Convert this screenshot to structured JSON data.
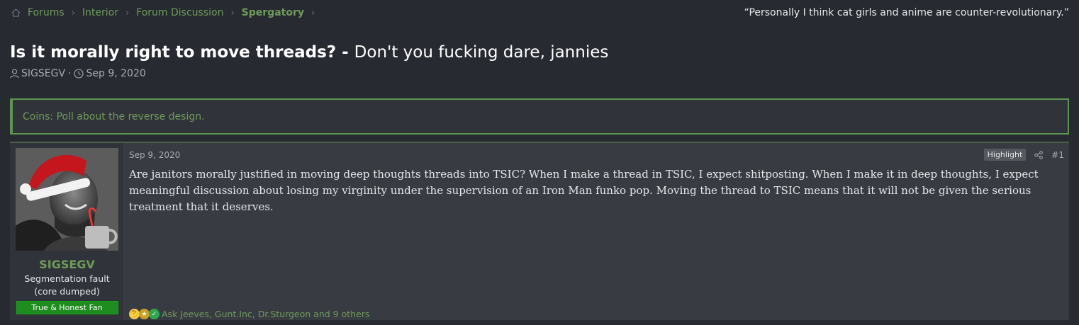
{
  "breadcrumb": {
    "items": [
      {
        "label": "Forums"
      },
      {
        "label": "Interior"
      },
      {
        "label": "Forum Discussion"
      },
      {
        "label": "Spergatory"
      }
    ]
  },
  "header_quote": "“Personally I think cat girls and anime are counter-revolutionary.”",
  "thread": {
    "title_prefix": "Is it morally right to move threads? -",
    "title_sub": "Don't you fucking dare, jannies",
    "author": "SIGSEGV",
    "date": "Sep 9, 2020"
  },
  "notice": {
    "text": "Coins: Poll about the reverse design."
  },
  "post": {
    "username": "SIGSEGV",
    "user_title": "Segmentation fault (core dumped)",
    "banner": "True & Honest Fan",
    "date": "Sep 9, 2020",
    "highlight_label": "Highlight",
    "post_number": "#1",
    "body": "Are janitors morally justified in moving deep thoughts threads into TSIC? When I make a thread in TSIC, I expect shitposting. When I make it in deep thoughts, I expect meaningful discussion about losing my virginity under the supervision of an Iron Man funko pop. Moving the thread to TSIC means that it will not be given the serious treatment that it deserves.",
    "reactions_text": "Ask Jeeves, Gunt.Inc, Dr.Sturgeon and 9 others",
    "reaction_icons": [
      "thinking-face-icon",
      "medal-icon",
      "check-icon"
    ]
  },
  "colors": {
    "background": "#272a31",
    "accent_green": "#6f9b5a",
    "post_bg": "#383b42",
    "banner_green": "#1e8c1e"
  }
}
